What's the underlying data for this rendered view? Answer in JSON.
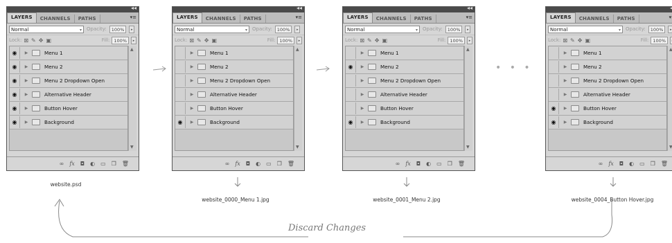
{
  "panel": {
    "tabs": [
      "LAYERS",
      "CHANNELS",
      "PATHS"
    ],
    "blend_mode": "Normal",
    "opacity_label": "Opacity:",
    "opacity_value": "100%",
    "lock_label": "Lock:",
    "fill_label": "Fill:",
    "fill_value": "100%",
    "layers": [
      "Menu 1",
      "Menu 2",
      "Menu 2 Dropdown Open",
      "Alternative Header",
      "Button Hover",
      "Background"
    ]
  },
  "panels": [
    {
      "visible": [
        true,
        true,
        true,
        true,
        true,
        true
      ],
      "caption": "website.psd"
    },
    {
      "visible": [
        false,
        false,
        false,
        false,
        false,
        true
      ],
      "caption": "website_0000_Menu 1.jpg"
    },
    {
      "visible": [
        false,
        true,
        false,
        false,
        false,
        true
      ],
      "caption": "website_0001_Menu 2.jpg"
    },
    {
      "visible": [
        false,
        false,
        false,
        false,
        true,
        true
      ],
      "caption": "website_0004_Button Hover.jpg"
    }
  ],
  "discard_label": "Discard Changes",
  "ellipsis": "• • •"
}
